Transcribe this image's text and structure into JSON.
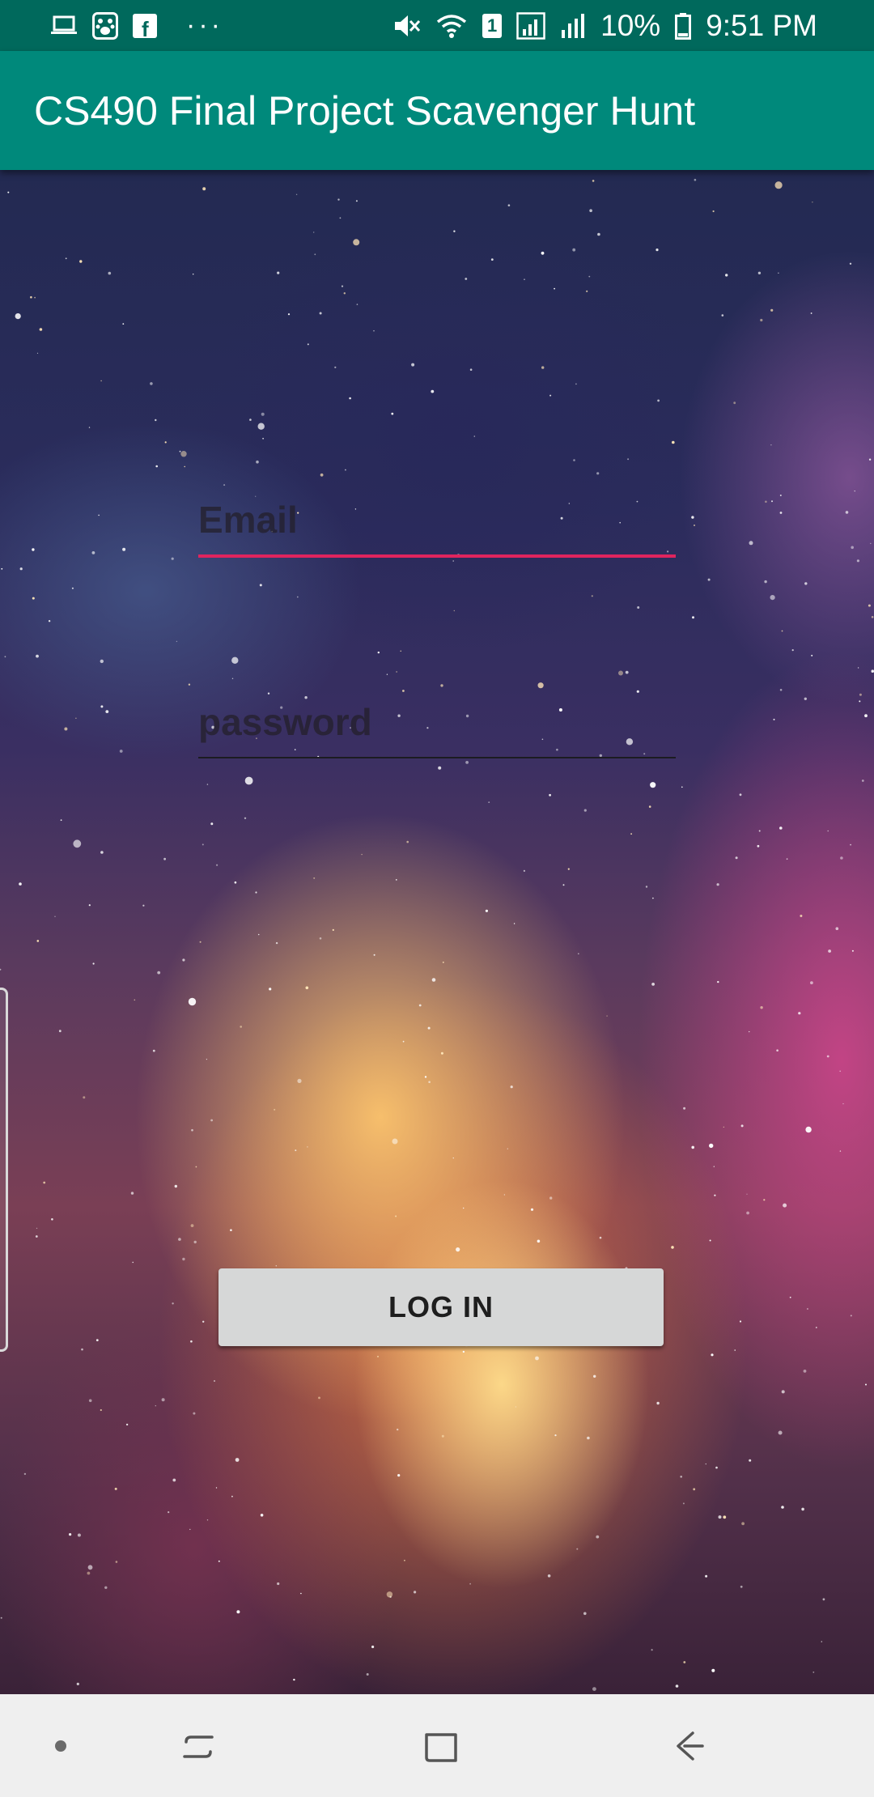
{
  "status_bar": {
    "battery_percent": "10%",
    "time": "9:51 PM",
    "left_icons": [
      "laptop-icon",
      "paw-icon",
      "facebook-icon",
      "more-dots-icon"
    ],
    "right_icons": [
      "mute-icon",
      "wifi-icon",
      "sim-1-icon",
      "signal-icon",
      "signal-2-icon",
      "battery-icon"
    ],
    "sim_number": "1",
    "more_dots": "···",
    "facebook_letter": "f"
  },
  "app_bar": {
    "title": "CS490 Final Project Scavenger Hunt",
    "color": "#00897b",
    "status_color": "#00695c"
  },
  "login_form": {
    "email_placeholder": "Email",
    "password_placeholder": "password",
    "email_value": "",
    "password_value": "",
    "focus_underline_color": "#e0245e"
  },
  "login_button": {
    "label": "LOG IN"
  },
  "nav_bar": {
    "items": [
      "dot-icon",
      "recent-apps-icon",
      "home-icon",
      "back-icon"
    ]
  }
}
